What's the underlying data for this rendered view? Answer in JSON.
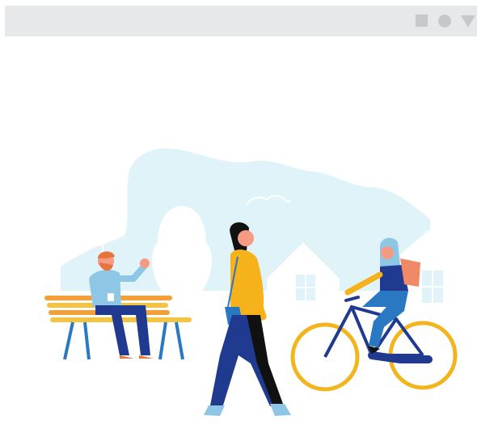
{
  "window": {
    "controls": [
      {
        "name": "minimize",
        "icon": "square-icon"
      },
      {
        "name": "maximize",
        "icon": "circle-icon"
      },
      {
        "name": "menu",
        "icon": "triangle-down-icon"
      }
    ],
    "chrome_color": "#e7e8e9",
    "control_color": "#c6c9cc"
  },
  "illustration": {
    "subject": "park scene",
    "palette": {
      "sky_blob": "#dff3f8",
      "bench_orange": "#f4a03a",
      "bench_yellow": "#f6c33c",
      "shirt_blue": "#8ec6e6",
      "yellow_top": "#f6b21b",
      "dark_blue": "#1f3a8f",
      "hair_dark": "#111111",
      "wheel_yellow": "#f2b51e",
      "backpack": "#f08a66",
      "skin_light": "#f59a83"
    }
  }
}
